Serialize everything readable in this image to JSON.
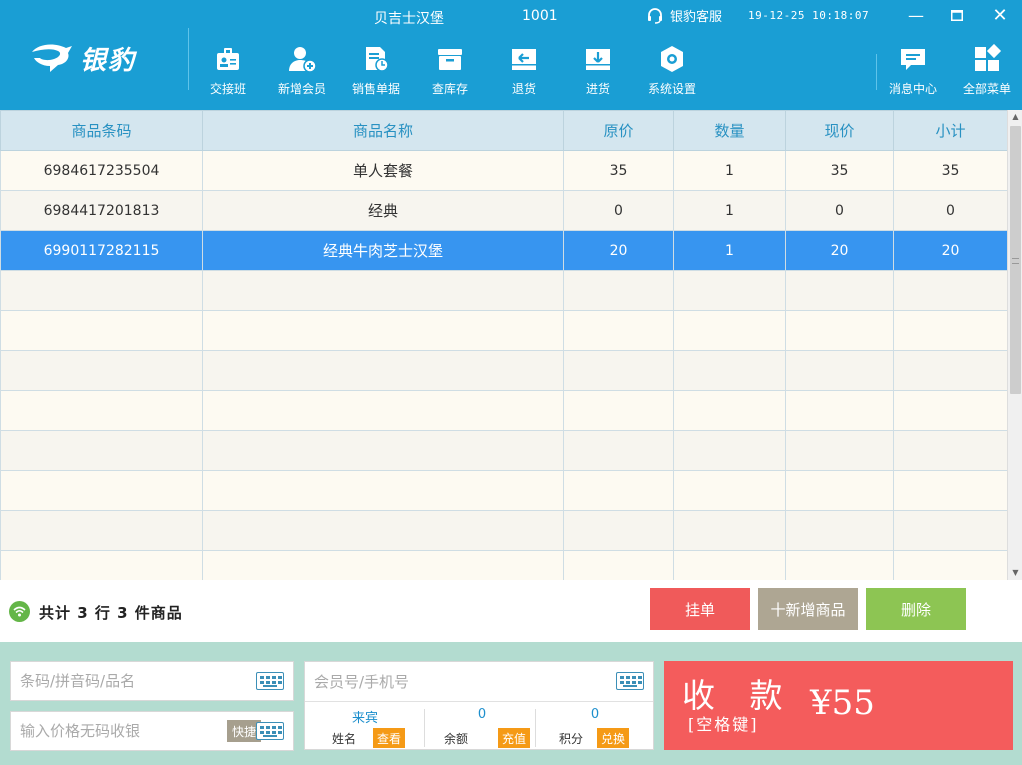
{
  "header": {
    "brand": "银豹",
    "store_name": "贝吉士汉堡",
    "store_no": "1001",
    "service_label": "银豹客服",
    "datetime": "19-12-25 10:18:07",
    "window_controls": {
      "minimize": "—",
      "maximize": "☐",
      "close": "✕"
    }
  },
  "toolbar": [
    {
      "label": "交接班",
      "icon": "handover-icon"
    },
    {
      "label": "新增会员",
      "icon": "add-member-icon"
    },
    {
      "label": "销售单据",
      "icon": "sales-receipt-icon"
    },
    {
      "label": "查库存",
      "icon": "inventory-icon"
    },
    {
      "label": "退货",
      "icon": "return-icon"
    },
    {
      "label": "进货",
      "icon": "stock-in-icon"
    },
    {
      "label": "系统设置",
      "icon": "settings-icon"
    }
  ],
  "toolbar_right": [
    {
      "label": "消息中心",
      "icon": "message-icon"
    },
    {
      "label": "全部菜单",
      "icon": "menu-grid-icon"
    }
  ],
  "table": {
    "columns": [
      "商品条码",
      "商品名称",
      "原价",
      "数量",
      "现价",
      "小计"
    ],
    "rows": [
      [
        "6984617235504",
        "单人套餐",
        "35",
        "1",
        "35",
        "35"
      ],
      [
        "6984417201813",
        "经典",
        "0",
        "1",
        "0",
        "0"
      ],
      [
        "6990117282115",
        "经典牛肉芝士汉堡",
        "20",
        "1",
        "20",
        "20"
      ]
    ],
    "selected_row": 2,
    "empty_rows": 8
  },
  "summary": {
    "text": "共计 3 行 3 件商品",
    "hang_button": "挂单",
    "add_button": "十新增商品",
    "delete_button": "删除"
  },
  "inputs": {
    "barcode_placeholder": "条码/拼音码/品名",
    "price_placeholder": "输入价格无码收银",
    "quick_label": "快捷",
    "member_placeholder": "会员号/手机号"
  },
  "member": {
    "name_value": "来宾",
    "name_key": "姓名",
    "name_action": "查看",
    "balance_value": "0",
    "balance_key": "余额",
    "balance_action": "充值",
    "points_value": "0",
    "points_key": "积分",
    "points_action": "兑换"
  },
  "pay": {
    "label": "收 款",
    "hint": "[空格键]",
    "amount": "¥55"
  },
  "colors": {
    "topbar": "#1a9ed4",
    "header_text": "#2891c2",
    "selected_row": "#3795f0",
    "hang_button": "#f05a5a",
    "add_button": "#aea693",
    "delete_button": "#8dc553",
    "pay_button": "#f45c5c",
    "bottom_panel": "#b3dcd0",
    "tag": "#f59a16"
  }
}
